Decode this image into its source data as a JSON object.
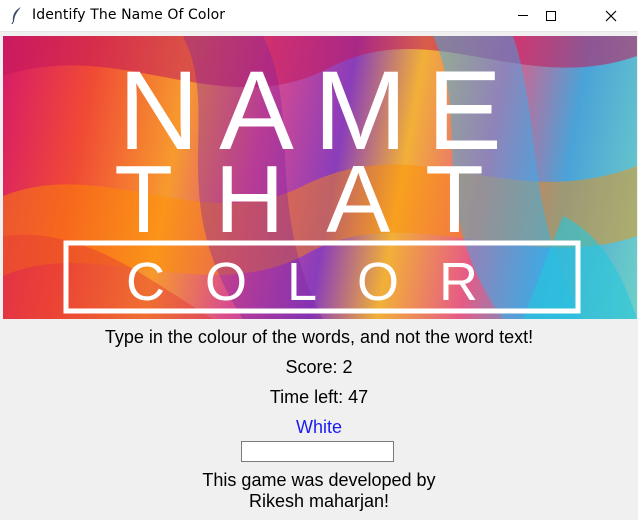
{
  "window": {
    "title": "Identify The Name Of Color",
    "app_icon": "feather-icon",
    "controls": [
      "minimize-icon",
      "maximize-icon",
      "close-icon"
    ]
  },
  "banner": {
    "line1": "NAME",
    "line2": "THAT",
    "line3": "COLOR"
  },
  "game": {
    "instruction": "Type in the colour of the words, and not the word text!",
    "score": "Score: 2",
    "time_left": "Time left: 47",
    "word": "White",
    "word_color": "#1c1cf0",
    "answer_value": ""
  },
  "credits": {
    "line1": "This game was developed by",
    "line2": "Rikesh maharjan!"
  }
}
